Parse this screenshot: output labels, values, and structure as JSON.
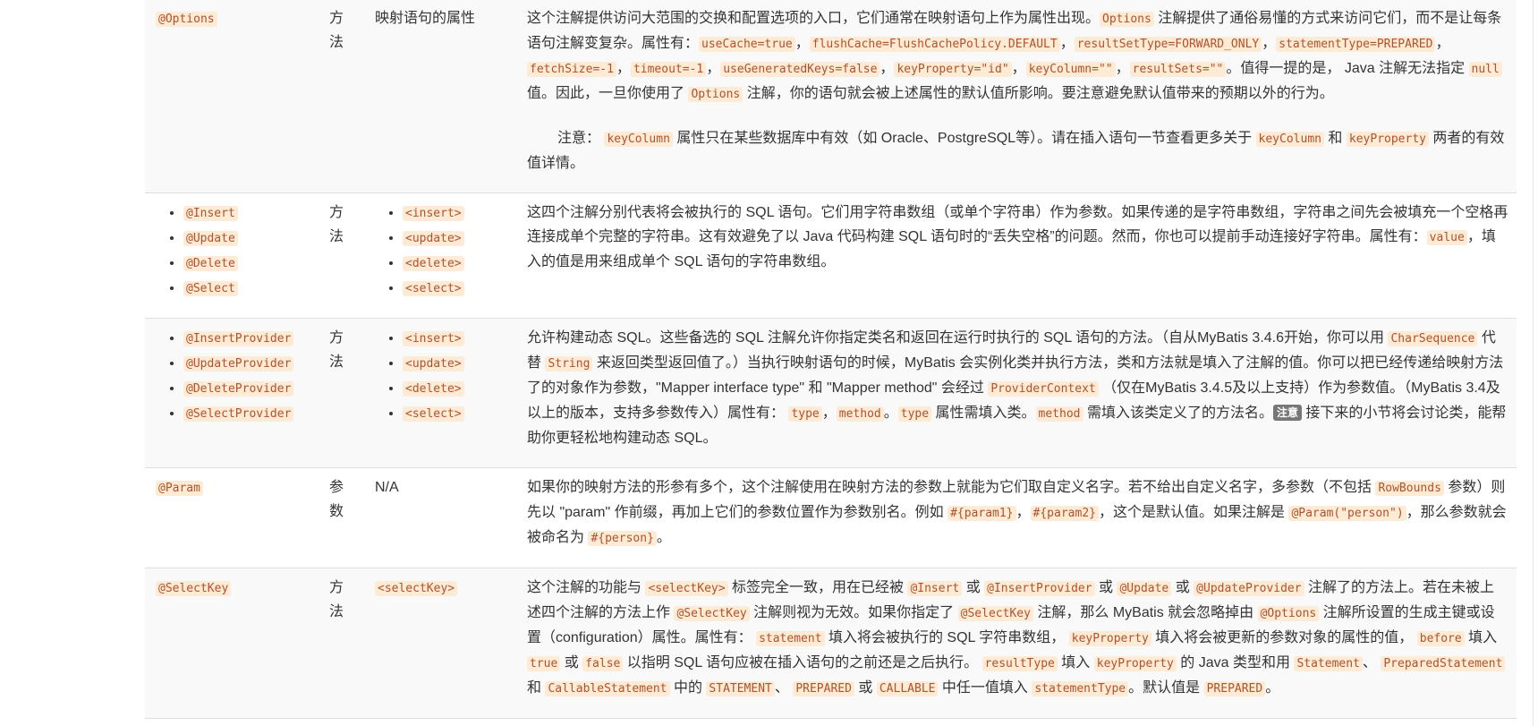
{
  "rows": [
    {
      "annotations": [
        "@Options"
      ],
      "type": "方法",
      "xml": "映射语句的属性",
      "xml_is_code": false
    },
    {
      "annotations": [
        "@Insert",
        "@Update",
        "@Delete",
        "@Select"
      ],
      "type": "方法",
      "xml": [
        "<insert>",
        "<update>",
        "<delete>",
        "<select>"
      ]
    },
    {
      "annotations": [
        "@InsertProvider",
        "@UpdateProvider",
        "@DeleteProvider",
        "@SelectProvider"
      ],
      "type": "方法",
      "xml": [
        "<insert>",
        "<update>",
        "<delete>",
        "<select>"
      ]
    },
    {
      "annotations": [
        "@Param"
      ],
      "type": "参数",
      "xml": "N/A"
    },
    {
      "annotations": [
        "@SelectKey"
      ],
      "type": "方法",
      "xml": "<selectKey>"
    }
  ],
  "desc": {
    "options": {
      "t1": "这个注解提供访问大范围的交换和配置选项的入口，它们通常在映射语句上作为属性出现。",
      "c1": "Options",
      "t2": " 注解提供了通俗易懂的方式来访问它们，而不是让每条语句注解变复杂。属性有：",
      "c2": "useCache=true",
      "s2": "，",
      "c3": "flushCache=FlushCachePolicy.DEFAULT",
      "s3": "，",
      "c4": "resultSetType=FORWARD_ONLY",
      "s4": "，",
      "c5": "statementType=PREPARED",
      "s5": "，",
      "c6": "fetchSize=-1",
      "s6": "，",
      "c7": "timeout=-1",
      "s7": "，",
      "c8": "useGeneratedKeys=false",
      "s8": "，",
      "c9": "keyProperty=\"id\"",
      "s9": "，",
      "c10": "keyColumn=\"\"",
      "s10": "，",
      "c11": "resultSets=\"\"",
      "t3": "。值得一提的是， Java 注解无法指定 ",
      "c12": "null",
      "t4": " 值。因此，一旦你使用了 ",
      "c13": "Options",
      "t5": " 注解，你的语句就会被上述属性的默认值所影响。要注意避免默认值带来的预期以外的行为。",
      "n1": "注意： ",
      "nc1": "keyColumn",
      "n2": " 属性只在某些数据库中有效（如 Oracle、PostgreSQL等）。请在插入语句一节查看更多关于 ",
      "nc2": "keyColumn",
      "n3": " 和 ",
      "nc3": "keyProperty",
      "n4": " 两者的有效值详情。"
    },
    "crud": {
      "t1": "这四个注解分别代表将会被执行的 SQL 语句。它们用字符串数组（或单个字符串）作为参数。如果传递的是字符串数组，字符串之间先会被填充一个空格再连接成单个完整的字符串。这有效避免了以 Java 代码构建 SQL 语句时的“丢失空格”的问题。然而，你也可以提前手动连接好字符串。属性有：",
      "c1": "value",
      "t2": "，填入的值是用来组成单个 SQL 语句的字符串数组。"
    },
    "provider": {
      "t1": "允许构建动态 SQL。这些备选的 SQL 注解允许你指定类名和返回在运行时执行的 SQL 语句的方法。（自从MyBatis 3.4.6开始，你可以用 ",
      "c1": "CharSequence",
      "t2": " 代替 ",
      "c2": "String",
      "t3": " 来返回类型返回值了。）当执行映射语句的时候，MyBatis 会实例化类并执行方法，类和方法就是填入了注解的值。你可以把已经传递给映射方法了的对象作为参数，\"Mapper interface type\" 和 \"Mapper method\" 会经过 ",
      "c3": "ProviderContext",
      "t4": " （仅在MyBatis 3.4.5及以上支持）作为参数值。（MyBatis 3.4及以上的版本，支持多参数传入）属性有： ",
      "c4": "type",
      "s4": "，",
      "c5": "method",
      "t5": "。",
      "c6": "type",
      "t6": " 属性需填入类。",
      "c7": "method",
      "t7": " 需填入该类定义了的方法名。",
      "badge": "注意",
      "t8": " 接下来的小节将会讨论类，能帮助你更轻松地构建动态 SQL。"
    },
    "param": {
      "t1": "如果你的映射方法的形参有多个，这个注解使用在映射方法的参数上就能为它们取自定义名字。若不给出自定义名字，多参数（不包括 ",
      "c1": "RowBounds",
      "t2": " 参数）则先以 \"param\" 作前缀，再加上它们的参数位置作为参数别名。例如 ",
      "c2": "#{param1}",
      "s2": "，",
      "c3": "#{param2}",
      "t3": "，这个是默认值。如果注解是 ",
      "c4": "@Param(\"person\")",
      "t4": "，那么参数就会被命名为 ",
      "c5": "#{person}",
      "t5": "。"
    },
    "selectkey": {
      "t1": "这个注解的功能与 ",
      "c1": "<selectKey>",
      "t2": " 标签完全一致，用在已经被 ",
      "c2": "@Insert",
      "t3": " 或 ",
      "c3": "@InsertProvider",
      "t4": " 或 ",
      "c4": "@Update",
      "t5": " 或 ",
      "c5": "@UpdateProvider",
      "t6": " 注解了的方法上。若在未被上述四个注解的方法上作 ",
      "c6": "@SelectKey",
      "t7": " 注解则视为无效。如果你指定了 ",
      "c7": "@SelectKey",
      "t8": " 注解，那么 MyBatis 就会忽略掉由 ",
      "c8": "@Options",
      "t9": " 注解所设置的生成主键或设置（configuration）属性。属性有： ",
      "c9": "statement",
      "t10": " 填入将会被执行的 SQL 字符串数组， ",
      "c10": "keyProperty",
      "t11": " 填入将会被更新的参数对象的属性的值， ",
      "c11": "before",
      "t12": " 填入 ",
      "c12": "true",
      "t13": " 或 ",
      "c13": "false",
      "t14": " 以指明 SQL 语句应被在插入语句的之前还是之后执行。 ",
      "c14": "resultType",
      "t15": " 填入 ",
      "c15": "keyProperty",
      "t16": " 的 Java 类型和用 ",
      "c16": "Statement",
      "t17": "、 ",
      "c17": "PreparedStatement",
      "t18": " 和 ",
      "c18": "CallableStatement",
      "t19": " 中的 ",
      "c19": "STATEMENT",
      "t20": "、 ",
      "c20": "PREPARED",
      "t21": " 或 ",
      "c21": "CALLABLE",
      "t22": " 中任一值填入 ",
      "c22": "statementType",
      "t23": "。默认值是 ",
      "c23": "PREPARED",
      "t24": "。"
    }
  }
}
